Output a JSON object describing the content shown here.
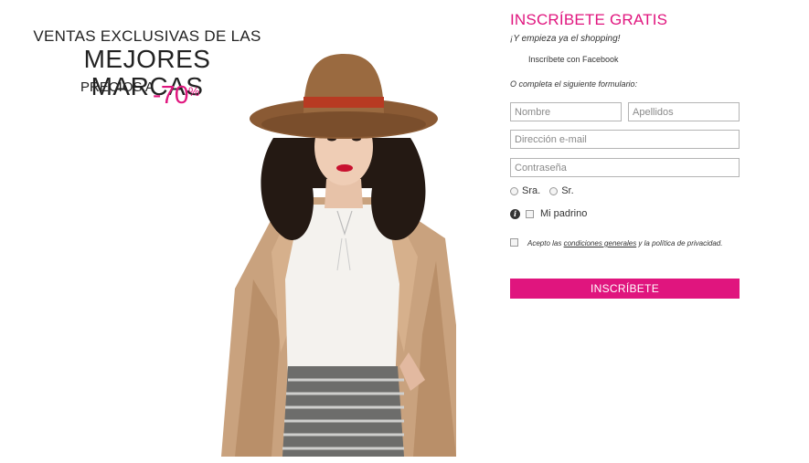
{
  "promo": {
    "line1": "VENTAS EXCLUSIVAS DE LAS",
    "line2": "MEJORES MARCAS",
    "prefix": "PRECIOS A",
    "discount": "-70",
    "percent_sign": "%"
  },
  "form": {
    "title": "INSCRÍBETE GRATIS",
    "subtitle": "¡Y empieza ya el shopping!",
    "facebook_label": "Inscríbete con Facebook",
    "or_text": "O completa el siguiente formulario:",
    "nombre_placeholder": "Nombre",
    "apellidos_placeholder": "Apellidos",
    "email_placeholder": "Dirección e-mail",
    "password_placeholder": "Contraseña",
    "radio_sra": "Sra.",
    "radio_sr": "Sr.",
    "info_icon": "i",
    "padrino_label": "Mi padrino",
    "terms_before": "Acepto las ",
    "terms_link": "condiciones generales",
    "terms_after": " y la política de privacidad.",
    "submit_label": "INSCRÍBETE"
  },
  "colors": {
    "accent": "#e0157e",
    "text": "#333333"
  }
}
